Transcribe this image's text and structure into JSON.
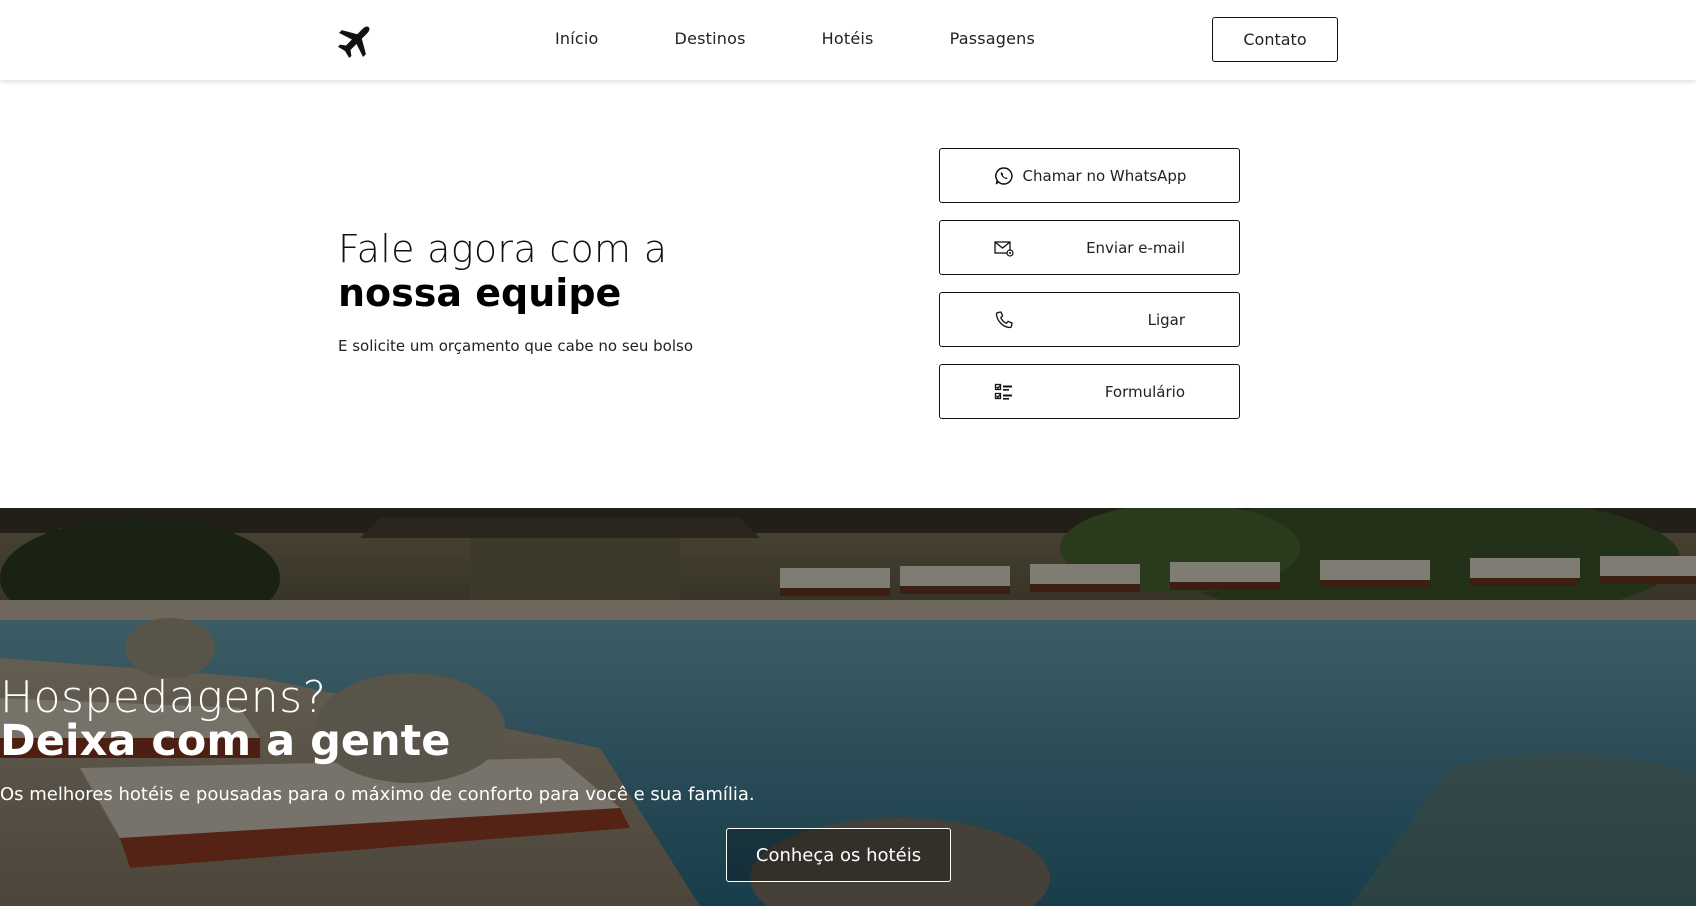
{
  "header": {
    "logo_icon": "airplane-icon",
    "nav": [
      "Início",
      "Destinos",
      "Hotéis",
      "Passagens"
    ],
    "contact_label": "Contato"
  },
  "contact": {
    "title_light": "Fale agora com a",
    "title_bold": "nossa equipe",
    "subtitle": "E solicite um orçamento que cabe no seu bolso",
    "actions": [
      {
        "label": "Chamar no WhatsApp",
        "icon": "whatsapp-icon"
      },
      {
        "label": "Enviar e-mail",
        "icon": "email-icon"
      },
      {
        "label": "Ligar",
        "icon": "phone-icon"
      },
      {
        "label": "Formulário",
        "icon": "checklist-icon"
      }
    ]
  },
  "hero": {
    "title_light": "Hospedagens?",
    "title_bold": "Deixa com a gente",
    "subtitle": "Os melhores hotéis e pousadas para o máximo de conforto para você e sua família.",
    "button_label": "Conheça os hotéis",
    "image": "hotel-pool-background"
  },
  "colors": {
    "text": "#111111",
    "border": "#111111",
    "hero_overlay": "#000000"
  }
}
